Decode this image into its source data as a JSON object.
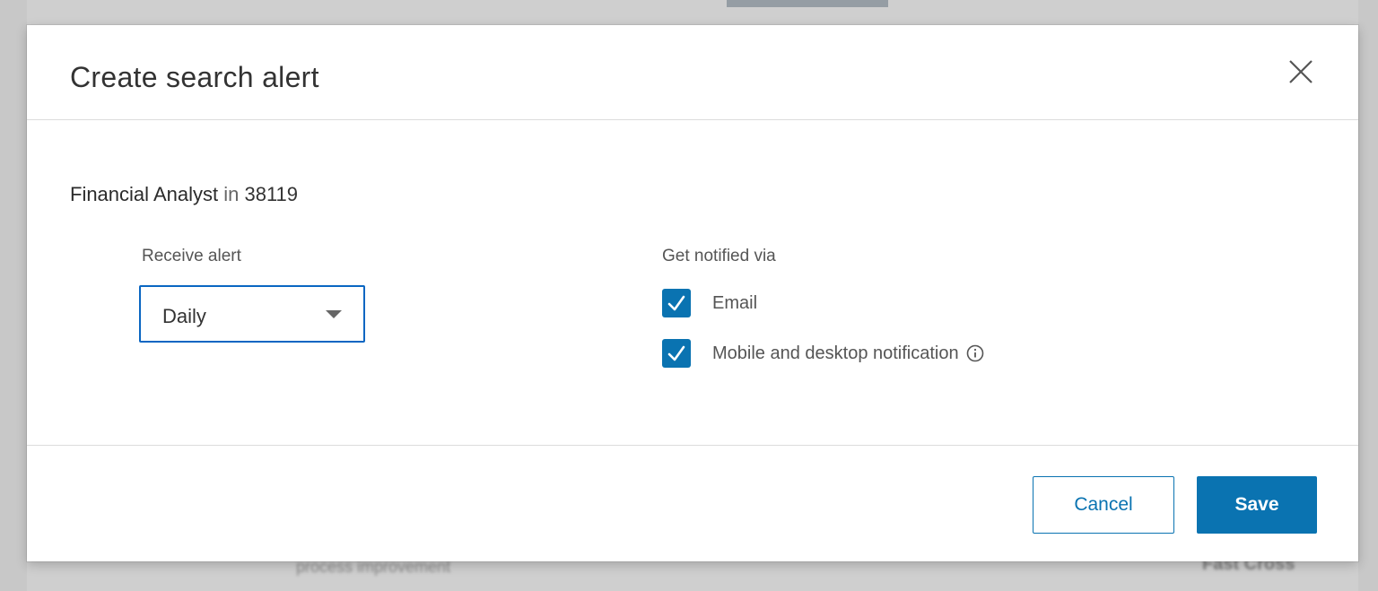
{
  "dialog": {
    "title": "Create search alert",
    "close_icon": "close-icon"
  },
  "search": {
    "keyword": "Financial Analyst",
    "separator": "in",
    "location": "38119"
  },
  "receive_alert": {
    "label": "Receive alert",
    "selected": "Daily",
    "icon": "chevron-down-icon"
  },
  "notify": {
    "label": "Get notified via",
    "options": [
      {
        "label": "Email",
        "checked": true
      },
      {
        "label": "Mobile and desktop notification",
        "checked": true,
        "icon": "info-icon"
      }
    ]
  },
  "footer": {
    "cancel_label": "Cancel",
    "save_label": "Save"
  },
  "background": {
    "left_text": "process improvement",
    "right_text": "Fast Cross"
  },
  "colors": {
    "accent": "#0a73b1",
    "focus_border": "#0a66c2",
    "text": "#333333"
  }
}
